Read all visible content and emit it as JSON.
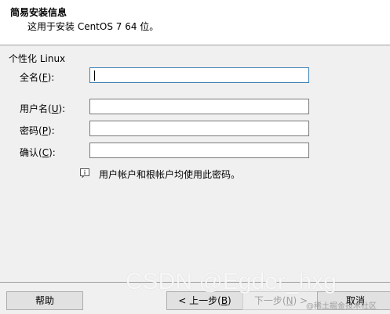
{
  "header": {
    "title": "简易安装信息",
    "subtitle": "这用于安装 CentOS 7 64 位。"
  },
  "group": {
    "label": "个性化 Linux"
  },
  "fields": {
    "fullname": {
      "label_pre": "全名(",
      "mnemonic": "F",
      "label_post": "):",
      "value": ""
    },
    "username": {
      "label_pre": "用户名(",
      "mnemonic": "U",
      "label_post": "):",
      "value": ""
    },
    "password": {
      "label_pre": "密码(",
      "mnemonic": "P",
      "label_post": "):",
      "value": ""
    },
    "confirm": {
      "label_pre": "确认(",
      "mnemonic": "C",
      "label_post": "):",
      "value": ""
    }
  },
  "info": {
    "icon": "info-icon",
    "text": "用户帐户和根帐户均使用此密码。"
  },
  "buttons": {
    "help": "帮助",
    "back_pre": "< 上一步(",
    "back_mnemonic": "B",
    "back_post": ")",
    "next_pre": "下一步(",
    "next_mnemonic": "N",
    "next_post": ") >",
    "cancel": "取消"
  },
  "watermark": {
    "main": "CSDN @Egder_hxg",
    "sub": "@稀土掘金技术社区"
  }
}
